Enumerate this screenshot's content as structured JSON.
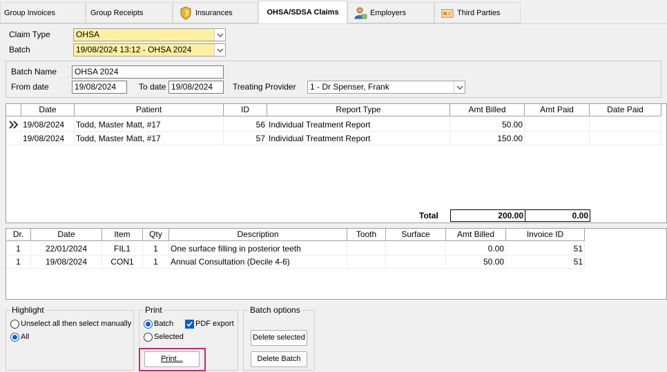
{
  "tabs": [
    {
      "label": "Group Invoices",
      "icon": ""
    },
    {
      "label": "Group Receipts",
      "icon": ""
    },
    {
      "label": "Insurances",
      "icon": "shield-icon"
    },
    {
      "label": "OHSA/SDSA Claims",
      "icon": ""
    },
    {
      "label": "Employers",
      "icon": "person-icon"
    },
    {
      "label": "Third Parties",
      "icon": "card-icon"
    }
  ],
  "form": {
    "claim_type_label": "Claim Type",
    "claim_type_value": "OHSA",
    "batch_label": "Batch",
    "batch_value": "19/08/2024 13:12 - OHSA 2024",
    "batch_name_label": "Batch Name",
    "batch_name_value": "OHSA 2024",
    "from_date_label": "From date",
    "from_date_value": "19/08/2024",
    "to_date_label": "To date",
    "to_date_value": "19/08/2024",
    "treating_provider_label": "Treating Provider",
    "treating_provider_value": "1 - Dr Spenser, Frank"
  },
  "claims_grid": {
    "headers": [
      "Date",
      "Patient",
      "ID",
      "Report Type",
      "Amt Billed",
      "Amt Paid",
      "Date Paid"
    ],
    "rows": [
      {
        "date": "19/08/2024",
        "patient": "Todd, Master Matt, #17",
        "id": "56",
        "report_type": "Individual Treatment Report",
        "amt_billed": "50.00",
        "amt_paid": "",
        "date_paid": ""
      },
      {
        "date": "19/08/2024",
        "patient": "Todd, Master Matt, #17",
        "id": "57",
        "report_type": "Individual Treatment Report",
        "amt_billed": "150.00",
        "amt_paid": "",
        "date_paid": ""
      }
    ],
    "total_label": "Total",
    "total_billed": "200.00",
    "total_paid": "0.00"
  },
  "items_grid": {
    "headers": [
      "Dr.",
      "Date",
      "Item",
      "Qty",
      "Description",
      "Tooth",
      "Surface",
      "Amt Billed",
      "Invoice ID"
    ],
    "rows": [
      {
        "dr": "1",
        "date": "22/01/2024",
        "item": "FIL1",
        "qty": "1",
        "description": "One surface filling in posterior teeth",
        "tooth": "",
        "surface": "",
        "amt_billed": "0.00",
        "invoice_id": "51"
      },
      {
        "dr": "1",
        "date": "19/08/2024",
        "item": "CON1",
        "qty": "1",
        "description": "Annual Consultation (Decile 4-6)",
        "tooth": "",
        "surface": "",
        "amt_billed": "50.00",
        "invoice_id": "51"
      }
    ]
  },
  "highlight": {
    "title": "Highlight",
    "option_manual": "Unselect all then select manually",
    "option_all": "All"
  },
  "print": {
    "title": "Print",
    "option_batch": "Batch",
    "option_selected": "Selected",
    "pdf_export": "PDF export",
    "print_button": "Print..."
  },
  "batch_options": {
    "title": "Batch options",
    "delete_selected": "Delete selected",
    "delete_batch": "Delete Batch"
  },
  "colors": {
    "combo_yellow": "#fff0a0",
    "accent_blue": "#0a5fd0",
    "annotation_pink": "#c8286a"
  }
}
